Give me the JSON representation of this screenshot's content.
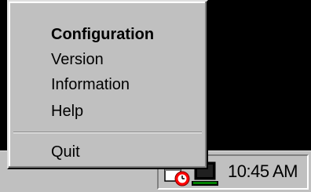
{
  "menu": {
    "items": [
      {
        "label": "Configuration",
        "bold": true
      },
      {
        "label": "Version"
      },
      {
        "label": "Information"
      },
      {
        "label": "Help"
      }
    ],
    "quit_label": "Quit"
  },
  "tray": {
    "clock": "10:45 AM",
    "icons": [
      "message-icon",
      "alarm-clock-icon",
      "monitor-icon"
    ]
  }
}
